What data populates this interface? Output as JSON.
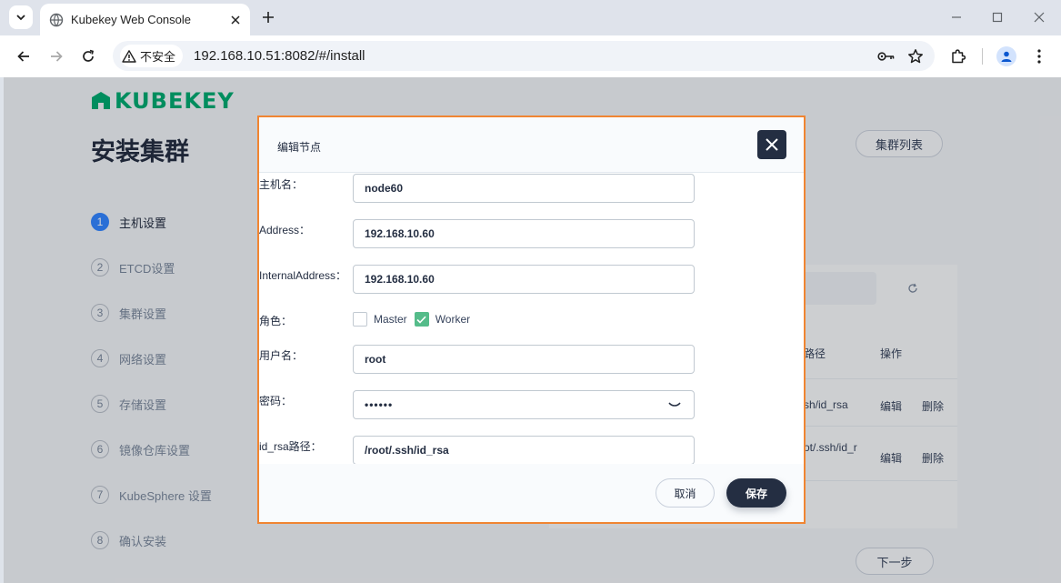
{
  "browser": {
    "tab_title": "Kubekey Web Console",
    "security_label": "不安全",
    "url": "192.168.10.51:8082/#/install"
  },
  "page": {
    "logo_text": "KUBEKEY",
    "title": "安装集群",
    "cluster_list_label": "集群列表",
    "next_label": "下一步",
    "steps": [
      {
        "num": "1",
        "label": "主机设置"
      },
      {
        "num": "2",
        "label": "ETCD设置"
      },
      {
        "num": "3",
        "label": "集群设置"
      },
      {
        "num": "4",
        "label": "网络设置"
      },
      {
        "num": "5",
        "label": "存储设置"
      },
      {
        "num": "6",
        "label": "镜像仓库设置"
      },
      {
        "num": "7",
        "label": "KubeSphere 设置"
      },
      {
        "num": "8",
        "label": "确认安装"
      }
    ],
    "table": {
      "col_path": "路径",
      "col_action": "操作",
      "rows": [
        {
          "path": "sh/id_rsa",
          "edit": "编辑",
          "delete": "删除"
        },
        {
          "path": "ot/.ssh/id_r",
          "edit": "编辑",
          "delete": "删除"
        }
      ]
    }
  },
  "modal": {
    "title": "编辑节点",
    "fields": {
      "hostname": {
        "label": "主机名：",
        "value": "node60"
      },
      "address": {
        "label": "Address：",
        "value": "192.168.10.60"
      },
      "internal_address": {
        "label": "InternalAddress：",
        "value": "192.168.10.60"
      },
      "role": {
        "label": "角色：",
        "master": {
          "label": "Master",
          "checked": false
        },
        "worker": {
          "label": "Worker",
          "checked": true
        }
      },
      "username": {
        "label": "用户名：",
        "value": "root"
      },
      "password": {
        "label": "密码：",
        "value": "••••••"
      },
      "id_rsa": {
        "label": "id_rsa路径：",
        "value": "/root/.ssh/id_rsa"
      }
    },
    "cancel_label": "取消",
    "save_label": "保存"
  },
  "colors": {
    "accent_dark": "#242e42",
    "checkbox_green": "#55bc8a",
    "step_active": "#3385ff",
    "logo_green": "#00a971",
    "modal_highlight": "#f08532"
  }
}
